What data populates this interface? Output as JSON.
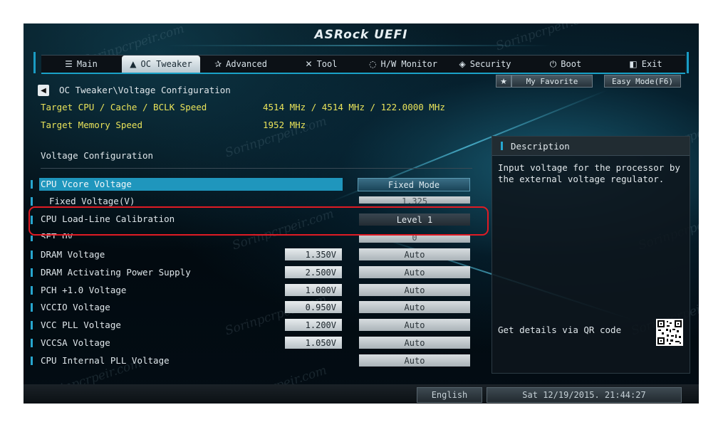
{
  "app_title": "ASRock UEFI",
  "tabs": [
    {
      "label": "Main",
      "icon": "list-icon"
    },
    {
      "label": "OC Tweaker",
      "icon": "rocket-icon",
      "active": true
    },
    {
      "label": "Advanced",
      "icon": "star-icon"
    },
    {
      "label": "Tool",
      "icon": "tools-icon"
    },
    {
      "label": "H/W Monitor",
      "icon": "monitor-icon"
    },
    {
      "label": "Security",
      "icon": "shield-icon"
    },
    {
      "label": "Boot",
      "icon": "power-icon"
    },
    {
      "label": "Exit",
      "icon": "exit-icon"
    }
  ],
  "favorite_label": "My Favorite",
  "easy_mode_label": "Easy Mode(F6)",
  "breadcrumb": "OC Tweaker\\Voltage Configuration",
  "info": [
    {
      "label": "Target CPU / Cache / BCLK Speed",
      "value": "4514 MHz / 4514 MHz / 122.0000 MHz"
    },
    {
      "label": "Target Memory Speed",
      "value": "1952 MHz"
    }
  ],
  "section_title": "Voltage Configuration",
  "settings": [
    {
      "label": "CPU Vcore Voltage",
      "voltage": "",
      "value": "Fixed Mode"
    },
    {
      "label": "Fixed Voltage(V)",
      "voltage": "",
      "value": "1.325"
    },
    {
      "label": "CPU Load-Line Calibration",
      "voltage": "",
      "value": "Level 1"
    },
    {
      "label": "SET OV",
      "voltage": "",
      "value": "0"
    },
    {
      "label": "DRAM Voltage",
      "voltage": "1.350V",
      "value": "Auto"
    },
    {
      "label": "DRAM Activating Power Supply",
      "voltage": "2.500V",
      "value": "Auto"
    },
    {
      "label": "PCH +1.0 Voltage",
      "voltage": "1.000V",
      "value": "Auto"
    },
    {
      "label": "VCCIO Voltage",
      "voltage": "0.950V",
      "value": "Auto"
    },
    {
      "label": "VCC PLL Voltage",
      "voltage": "1.200V",
      "value": "Auto"
    },
    {
      "label": "VCCSA Voltage",
      "voltage": "1.050V",
      "value": "Auto"
    },
    {
      "label": "CPU Internal PLL Voltage",
      "voltage": "",
      "value": "Auto"
    }
  ],
  "description": {
    "title": "Description",
    "text": "Input voltage for the processor by the external voltage regulator.",
    "qr_text": "Get details via QR code"
  },
  "footer": {
    "language": "English",
    "datetime": "Sat 12/19/2015. 21:44:27"
  },
  "watermark": "Sorinpcrpeir.com",
  "colors": {
    "accent": "#1f96bd",
    "highlight_outline": "#e01b24",
    "info_text": "#e9e35a"
  }
}
